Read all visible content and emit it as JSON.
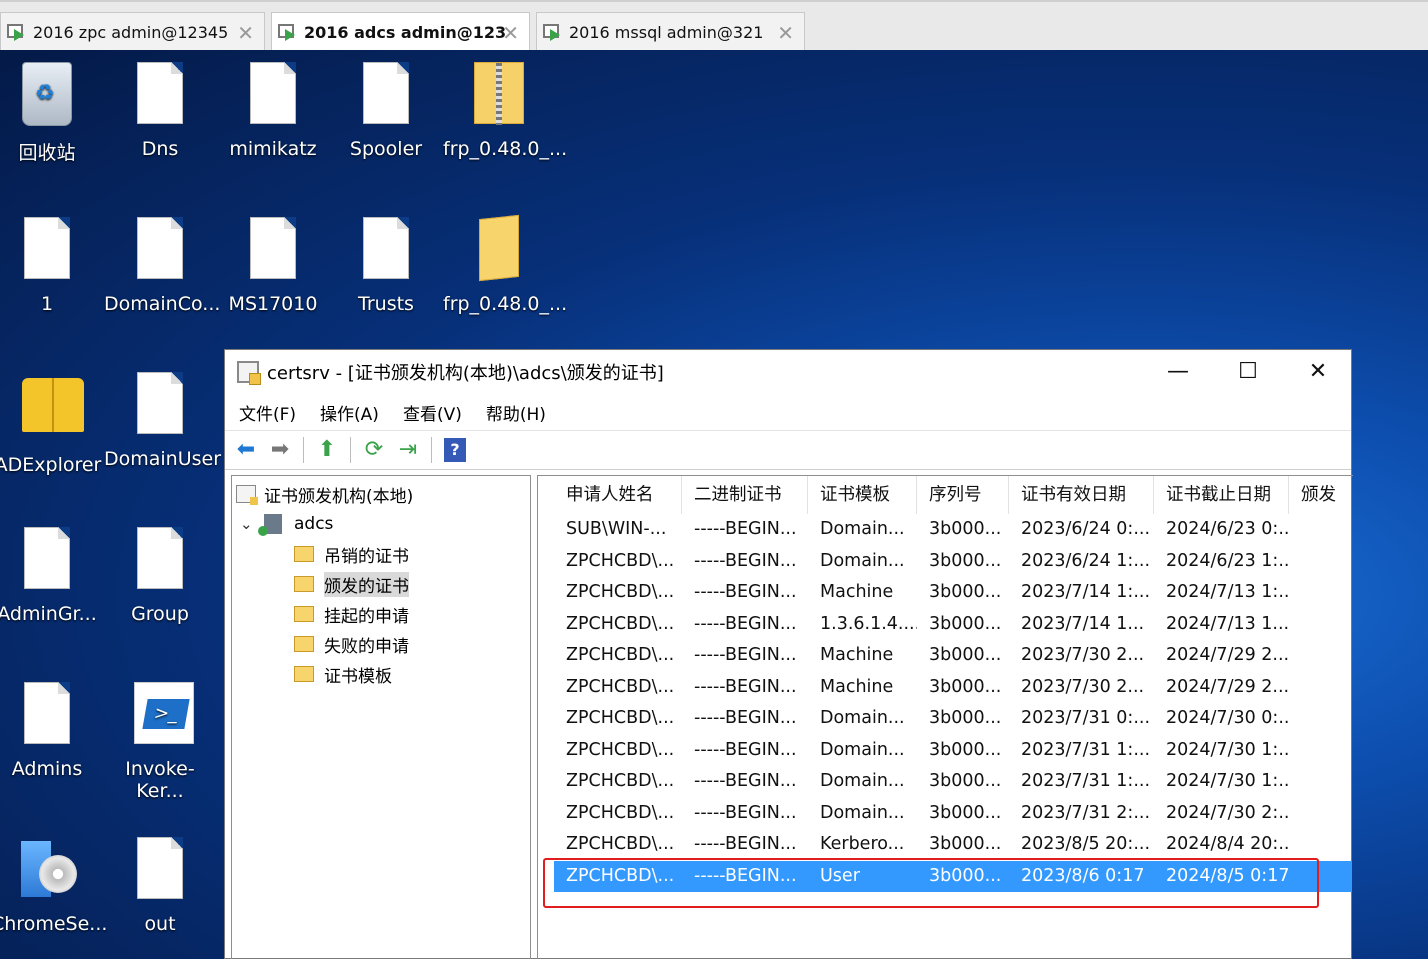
{
  "tabs": [
    {
      "label": "2016 zpc admin@12345",
      "active": false
    },
    {
      "label": "2016 adcs admin@123",
      "active": true
    },
    {
      "label": "2016 mssql admin@321",
      "active": false
    }
  ],
  "tab_close_glyph": "✕",
  "desktop_icons": [
    {
      "label": "回收站",
      "icon": "recycle-bin-icon"
    },
    {
      "label": "Dns",
      "icon": "text-file-icon"
    },
    {
      "label": "mimikatz",
      "icon": "text-file-icon"
    },
    {
      "label": "Spooler",
      "icon": "text-file-icon"
    },
    {
      "label": "frp_0.48.0_...",
      "icon": "zip-folder-icon"
    },
    {
      "label": "1",
      "icon": "text-file-icon"
    },
    {
      "label": "DomainCo...",
      "icon": "text-file-icon"
    },
    {
      "label": "MS17010",
      "icon": "text-file-icon"
    },
    {
      "label": "Trusts",
      "icon": "text-file-icon"
    },
    {
      "label": "frp_0.48.0_...",
      "icon": "folder-icon"
    },
    {
      "label": "ADExplorer",
      "icon": "book-icon"
    },
    {
      "label": "DomainUser",
      "icon": "text-file-icon"
    },
    {
      "label": "AdminGr...",
      "icon": "text-file-icon"
    },
    {
      "label": "Group",
      "icon": "text-file-icon"
    },
    {
      "label": "Admins",
      "icon": "text-file-icon"
    },
    {
      "label": "Invoke-Ker...",
      "icon": "powershell-script-icon"
    },
    {
      "label": "ChromeSe...",
      "icon": "installer-cd-icon"
    },
    {
      "label": "out",
      "icon": "text-file-icon"
    }
  ],
  "window": {
    "title": "certsrv - [证书颁发机构(本地)\\adcs\\颁发的证书]",
    "minimize": "—",
    "maximize": "☐",
    "close": "✕",
    "menu": [
      "文件(F)",
      "操作(A)",
      "查看(V)",
      "帮助(H)"
    ],
    "toolbar": {
      "back": "back-arrow-icon",
      "forward": "forward-arrow-icon",
      "up": "up-folder-icon",
      "refresh": "refresh-icon",
      "export": "export-list-icon",
      "help": "?"
    }
  },
  "tree": {
    "root": "证书颁发机构(本地)",
    "server": "adcs",
    "chevron": "⌄",
    "folders": [
      "吊销的证书",
      "颁发的证书",
      "挂起的申请",
      "失败的申请",
      "证书模板"
    ],
    "selected_index": 1
  },
  "list": {
    "columns": [
      "申请人姓名",
      "二进制证书",
      "证书模板",
      "序列号",
      "证书有效日期",
      "证书截止日期",
      "颁发"
    ],
    "rows": [
      [
        "SUB\\WIN-...",
        "-----BEGIN...",
        "Domain...",
        "3b000...",
        "2023/6/24 0:...",
        "2024/6/23 0:..."
      ],
      [
        "ZPCHCBD\\...",
        "-----BEGIN...",
        "Domain...",
        "3b000...",
        "2023/6/24 1:...",
        "2024/6/23 1:..."
      ],
      [
        "ZPCHCBD\\...",
        "-----BEGIN...",
        "Machine",
        "3b000...",
        "2023/7/14 1:...",
        "2024/7/13 1:..."
      ],
      [
        "ZPCHCBD\\...",
        "-----BEGIN...",
        "1.3.6.1.4....",
        "3b000...",
        "2023/7/14 1...",
        "2024/7/13 1..."
      ],
      [
        "ZPCHCBD\\...",
        "-----BEGIN...",
        "Machine",
        "3b000...",
        "2023/7/30 2...",
        "2024/7/29 2..."
      ],
      [
        "ZPCHCBD\\...",
        "-----BEGIN...",
        "Machine",
        "3b000...",
        "2023/7/30 2...",
        "2024/7/29 2..."
      ],
      [
        "ZPCHCBD\\...",
        "-----BEGIN...",
        "Domain...",
        "3b000...",
        "2023/7/31 0:...",
        "2024/7/30 0:..."
      ],
      [
        "ZPCHCBD\\...",
        "-----BEGIN...",
        "Domain...",
        "3b000...",
        "2023/7/31 1:...",
        "2024/7/30 1:..."
      ],
      [
        "ZPCHCBD\\...",
        "-----BEGIN...",
        "Domain...",
        "3b000...",
        "2023/7/31 1:...",
        "2024/7/30 1:..."
      ],
      [
        "ZPCHCBD\\...",
        "-----BEGIN...",
        "Domain...",
        "3b000...",
        "2023/7/31 2:...",
        "2024/7/30 2:..."
      ],
      [
        "ZPCHCBD\\...",
        "-----BEGIN...",
        "Kerbero...",
        "3b000...",
        "2023/8/5 20:...",
        "2024/8/4 20:..."
      ],
      [
        "ZPCHCBD\\...",
        "-----BEGIN...",
        "User",
        "3b000...",
        "2023/8/6 0:17",
        "2024/8/5 0:17"
      ]
    ],
    "selected_row": 11,
    "highlight_color": "#3399ff",
    "annotation_box_color": "#e11d1d"
  }
}
